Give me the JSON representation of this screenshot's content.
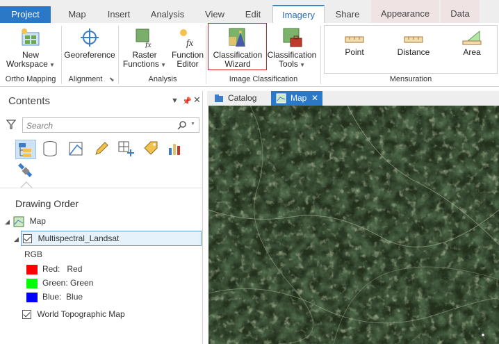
{
  "tabs": [
    {
      "label": "Project"
    },
    {
      "label": "Map"
    },
    {
      "label": "Insert"
    },
    {
      "label": "Analysis"
    },
    {
      "label": "View"
    },
    {
      "label": "Edit"
    },
    {
      "label": "Imagery"
    },
    {
      "label": "Share"
    },
    {
      "label": "Appearance"
    },
    {
      "label": "Data"
    }
  ],
  "ribbon": {
    "new_workspace": "New\nWorkspace",
    "georeference": "Georeference",
    "raster_functions": "Raster\nFunctions",
    "function_editor": "Function\nEditor",
    "classification_wizard": "Classification\nWizard",
    "classification_tools": "Classification\nTools",
    "point": "Point",
    "distance": "Distance",
    "area": "Area",
    "groups": {
      "ortho": "Ortho Mapping",
      "alignment": "Alignment",
      "analysis": "Analysis",
      "image_classification": "Image Classification",
      "mensuration": "Mensuration"
    }
  },
  "contents": {
    "title": "Contents",
    "search_placeholder": "Search",
    "drawing_order": "Drawing Order",
    "map_label": "Map",
    "layer": "Multispectral_Landsat",
    "rgb_label": "RGB",
    "bands": [
      {
        "label": "Red:   Red",
        "color": "#ff0000"
      },
      {
        "label": "Green: Green",
        "color": "#00ff00"
      },
      {
        "label": "Blue:  Blue",
        "color": "#0000ff"
      }
    ],
    "basemap": "World Topographic Map"
  },
  "map_tabs": {
    "catalog": "Catalog",
    "map": "Map"
  }
}
